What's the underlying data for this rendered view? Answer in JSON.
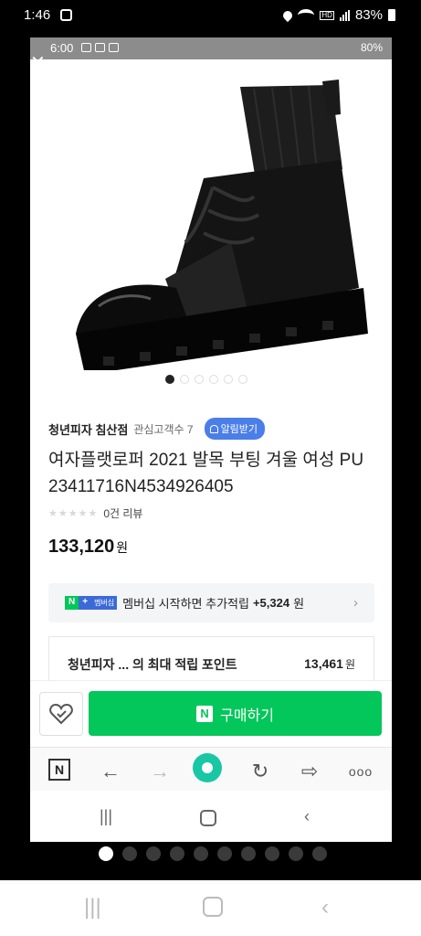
{
  "outer_status": {
    "time": "1:46",
    "battery": "83%"
  },
  "inner_status": {
    "time": "6:00",
    "battery": "80%"
  },
  "image_carousel": {
    "total": 6,
    "active": 0
  },
  "store": {
    "name": "청년피자 침산점",
    "followers": "관심고객수 7",
    "alert_label": "알림받기"
  },
  "product": {
    "title": "여자플랫로퍼 2021 발목 부팅 겨울 여성 PU 23411716N4534926405",
    "stars": "★★★★★",
    "reviews": "0건 리뷰",
    "price": "133,120",
    "price_unit": "원"
  },
  "membership": {
    "badge_n": "N",
    "badge_plus": "+",
    "badge_text": "멤버십",
    "text": "멤버십 시작하면 추가적립",
    "amount": "+5,324",
    "unit": "원"
  },
  "points": {
    "label": "청년피자 ...  의 최대 적립 포인트",
    "value": "13,461",
    "unit": "원"
  },
  "buy": {
    "logo": "N",
    "label": "구매하기"
  },
  "browser": {
    "n_label": "N",
    "more": "ooo"
  },
  "page_dots": {
    "total": 10,
    "active": 0
  },
  "colors": {
    "naver_green": "#03c75a",
    "alert_blue": "#4a7ee8",
    "home_teal": "#19c7a4"
  }
}
